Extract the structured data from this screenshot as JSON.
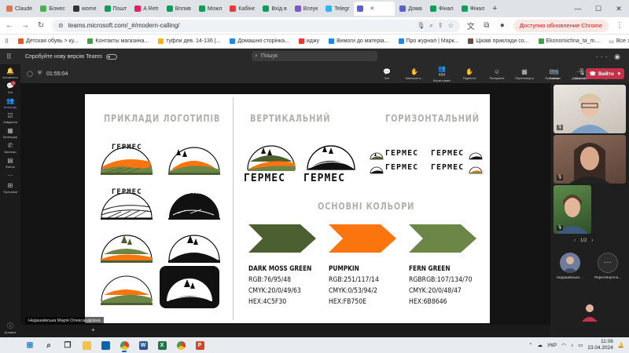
{
  "browser": {
    "tabs": [
      {
        "label": "Claude",
        "color": "#d97757"
      },
      {
        "label": "Бізнес",
        "color": "#4caf50"
      },
      {
        "label": "wome",
        "color": "#333333"
      },
      {
        "label": "Пошт",
        "color": "#0f9d58"
      },
      {
        "label": "A Retr",
        "color": "#e91e63"
      },
      {
        "label": "Вплив",
        "color": "#0f9d58"
      },
      {
        "label": "Можл",
        "color": "#0f9d58"
      },
      {
        "label": "Кабінє",
        "color": "#e53935"
      },
      {
        "label": "Вхід в",
        "color": "#0f9d58"
      },
      {
        "label": "Всеук",
        "color": "#7e57c2"
      },
      {
        "label": "Telegr",
        "color": "#29b6f6"
      },
      {
        "label": "",
        "color": "#5b5fc7",
        "active": true
      },
      {
        "label": "Дома",
        "color": "#5b5fc7"
      },
      {
        "label": "Фінал",
        "color": "#0f9d58"
      },
      {
        "label": "Фінал",
        "color": "#0f9d58"
      }
    ],
    "url": "teams.microsoft.com/_#/modern-calling/",
    "update_label": "Доступно обновление Chrome",
    "bookmarks": [
      {
        "label": "Детская обувь > ку...",
        "color": "#f4511e"
      },
      {
        "label": "Контакты магазина...",
        "color": "#43a047"
      },
      {
        "label": "туфли дев. 14-136 |...",
        "color": "#ffb300"
      },
      {
        "label": "Домашня сторінка...",
        "color": "#1e88e5"
      },
      {
        "label": "иджу",
        "color": "#e53935"
      },
      {
        "label": "Вимоги до матеріа...",
        "color": "#1e88e5"
      },
      {
        "label": "Про журнал | Марк...",
        "color": "#1e88e5"
      },
      {
        "label": "Цікаві приклади со...",
        "color": "#6d4c41"
      },
      {
        "label": "Ekonomichna_ta_m...",
        "color": "#43a047"
      }
    ],
    "all_bookmarks": "Все закладки"
  },
  "teams": {
    "new_version_label": "Спробуйте нову версію Teams",
    "search_placeholder": "Пошук",
    "rail": [
      {
        "label": "Активність",
        "icon": "bell-icon"
      },
      {
        "label": "Чат",
        "icon": "chat-icon",
        "badge": "1"
      },
      {
        "label": "Команди",
        "icon": "teams-icon",
        "active": true
      },
      {
        "label": "Завдання",
        "icon": "tasks-icon"
      },
      {
        "label": "Календар",
        "icon": "calendar-icon"
      },
      {
        "label": "Виклики",
        "icon": "phone-icon"
      },
      {
        "label": "Файли",
        "icon": "files-icon"
      },
      {
        "label": "...",
        "icon": "more-icon"
      },
      {
        "label": "Програми",
        "icon": "apps-icon"
      }
    ],
    "help_label": "Довідка",
    "meeting": {
      "timer": "01:55:04",
      "tools": [
        {
          "label": "Чат",
          "icon": "chat-icon"
        },
        {
          "label": "Записані п...",
          "icon": "hand-icon"
        },
        {
          "label": "Користувачі",
          "icon": "people-icon",
          "count": "494"
        },
        {
          "label": "Підвести",
          "icon": "raise-hand-icon"
        },
        {
          "label": "Реагувати",
          "icon": "react-icon"
        },
        {
          "label": "Переглянути",
          "icon": "view-icon"
        },
        {
          "label": "Програми",
          "icon": "apps-icon"
        },
        {
          "label": "Додатково",
          "icon": "more-icon"
        }
      ],
      "devices": [
        {
          "label": "Камера",
          "icon": "camera-icon"
        },
        {
          "label": "Мікрофон",
          "icon": "mic-off-icon"
        },
        {
          "label": "Надіслати",
          "icon": "share-icon"
        }
      ],
      "leave_label": "Вийти",
      "presenter_name": "Недашківська Марія Олександрівна"
    },
    "participants": {
      "pager": "1/2",
      "attendees": [
        {
          "label": "Недашківська ..."
        },
        {
          "label": "Переглянути в..."
        }
      ]
    }
  },
  "slide": {
    "heading_examples": "ПРИКЛАДИ ЛОГОТИПІВ",
    "heading_vertical": "ВЕРТИКАЛЬНИЙ",
    "heading_horizontal": "ГОРИЗОНТАЛЬНИЙ",
    "heading_colors": "ОСНОВНІ КОЛЬОРИ",
    "brand": "ГЕРМЕС",
    "colors": [
      {
        "name": "DARK MOSS GREEN",
        "rgb": "RGB:76/95/48",
        "cmyk": "CMYK:20/0/49/63",
        "hex": "HEX:4C5F30",
        "swatch": "#4C5F30"
      },
      {
        "name": "PUMPKIN",
        "rgb": "RGB:251/117/14",
        "cmyk": "CMYK:0/53/94/2",
        "hex": "HEX:FB750E",
        "swatch": "#FB750E"
      },
      {
        "name": "FERN GREEN",
        "rgb": "RGBRGB:107/134/70",
        "cmyk": "CMYK:20/0/48/47",
        "hex": "HEX:6B8646",
        "swatch": "#6B8646"
      }
    ]
  },
  "taskbar": {
    "apps": [
      {
        "icon": "windows-start-icon",
        "color": "#0067c0"
      },
      {
        "icon": "search-icon",
        "color": "#333333"
      },
      {
        "icon": "task-view-icon",
        "color": "#333333"
      },
      {
        "icon": "file-explorer-icon",
        "color": "#f2c14e"
      },
      {
        "icon": "outlook-icon",
        "color": "#0a64ad"
      },
      {
        "icon": "chrome-icon",
        "color": "#e53935",
        "active": true
      },
      {
        "icon": "word-icon",
        "color": "#2b579a"
      },
      {
        "icon": "excel-icon",
        "color": "#217346"
      },
      {
        "icon": "chrome-icon",
        "color": "#e53935"
      },
      {
        "icon": "powerpoint-icon",
        "color": "#d24726"
      }
    ],
    "language": "УКР",
    "time": "11:06",
    "date": "23.04.2024"
  }
}
